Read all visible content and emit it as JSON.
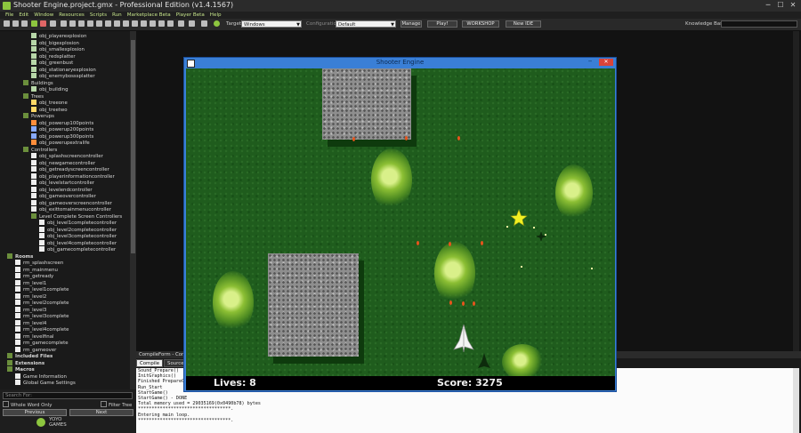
{
  "window": {
    "title": "Shooter Engine.project.gmx  -  Professional Edition (v1.4.1567)",
    "min": "─",
    "max": "☐",
    "close": "✕"
  },
  "menu": [
    "File",
    "Edit",
    "Window",
    "Resources",
    "Scripts",
    "Run",
    "Marketplace Beta",
    "Player Beta",
    "Help"
  ],
  "toolbar": {
    "target_label": "Target",
    "target_value": "Windows",
    "config_label": "Configuration",
    "config_value": "Default",
    "manage": "Manage",
    "play": "Play!",
    "workshop": "WORKSHOP",
    "new_ide": "New IDE",
    "kb_label": "Knowledge Base:"
  },
  "tree": [
    {
      "label": "obj_playerexplosion",
      "indent": 3,
      "icon": "obj"
    },
    {
      "label": "obj_bigexplosion",
      "indent": 3,
      "icon": "obj"
    },
    {
      "label": "obj_smallexplosion",
      "indent": 3,
      "icon": "obj"
    },
    {
      "label": "obj_redsplatter",
      "indent": 3,
      "icon": "obj"
    },
    {
      "label": "obj_greenbust",
      "indent": 3,
      "icon": "obj"
    },
    {
      "label": "obj_stationaryexplosion",
      "indent": 3,
      "icon": "obj"
    },
    {
      "label": "obj_enemybosssplatter",
      "indent": 3,
      "icon": "obj"
    },
    {
      "label": "Buildings",
      "indent": 2,
      "icon": "fld"
    },
    {
      "label": "obj_building",
      "indent": 3,
      "icon": "obj"
    },
    {
      "label": "Trees",
      "indent": 2,
      "icon": "fld"
    },
    {
      "label": "obj_treeone",
      "indent": 3,
      "icon": "tri"
    },
    {
      "label": "obj_treetwo",
      "indent": 3,
      "icon": "tri"
    },
    {
      "label": "Powerups",
      "indent": 2,
      "icon": "fld"
    },
    {
      "label": "obj_powerup100points",
      "indent": 3,
      "icon": "sel"
    },
    {
      "label": "obj_powerup200points",
      "indent": 3,
      "icon": "spr"
    },
    {
      "label": "obj_powerup300points",
      "indent": 3,
      "icon": "spr"
    },
    {
      "label": "obj_powerupextralife",
      "indent": 3,
      "icon": "sel"
    },
    {
      "label": "Controllers",
      "indent": 2,
      "icon": "fld"
    },
    {
      "label": "obj_splashscreencontroller",
      "indent": 3,
      "icon": "scr"
    },
    {
      "label": "obj_newgamecontroller",
      "indent": 3,
      "icon": "scr"
    },
    {
      "label": "obj_getreadyscreencontroller",
      "indent": 3,
      "icon": "scr"
    },
    {
      "label": "obj_playerinformationcontroller",
      "indent": 3,
      "icon": "scr"
    },
    {
      "label": "obj_levelstartcontroller",
      "indent": 3,
      "icon": "scr"
    },
    {
      "label": "obj_levelendcontroller",
      "indent": 3,
      "icon": "scr"
    },
    {
      "label": "obj_gameovercontroller",
      "indent": 3,
      "icon": "scr"
    },
    {
      "label": "obj_gameoverscreencontroller",
      "indent": 3,
      "icon": "scr"
    },
    {
      "label": "obj_exittomainmenucontroller",
      "indent": 3,
      "icon": "scr"
    },
    {
      "label": "Level Complete Screen Controllers",
      "indent": 3,
      "icon": "fld"
    },
    {
      "label": "obj_level1completecontroller",
      "indent": 4,
      "icon": "scr"
    },
    {
      "label": "obj_level2completecontroller",
      "indent": 4,
      "icon": "scr"
    },
    {
      "label": "obj_level3completecontroller",
      "indent": 4,
      "icon": "scr"
    },
    {
      "label": "obj_level4completecontroller",
      "indent": 4,
      "icon": "scr"
    },
    {
      "label": "obj_gamecompletecontroller",
      "indent": 4,
      "icon": "scr"
    },
    {
      "label": "Rooms",
      "indent": 0,
      "icon": "fld",
      "bold": true
    },
    {
      "label": "rm_splashscreen",
      "indent": 1,
      "icon": "scr"
    },
    {
      "label": "rm_mainmenu",
      "indent": 1,
      "icon": "scr"
    },
    {
      "label": "rm_getready",
      "indent": 1,
      "icon": "scr"
    },
    {
      "label": "rm_level1",
      "indent": 1,
      "icon": "scr"
    },
    {
      "label": "rm_level1complete",
      "indent": 1,
      "icon": "scr"
    },
    {
      "label": "rm_level2",
      "indent": 1,
      "icon": "scr"
    },
    {
      "label": "rm_level2complete",
      "indent": 1,
      "icon": "scr"
    },
    {
      "label": "rm_level3",
      "indent": 1,
      "icon": "scr"
    },
    {
      "label": "rm_level3complete",
      "indent": 1,
      "icon": "scr"
    },
    {
      "label": "rm_level4",
      "indent": 1,
      "icon": "scr"
    },
    {
      "label": "rm_level4complete",
      "indent": 1,
      "icon": "scr"
    },
    {
      "label": "rm_levelfinal",
      "indent": 1,
      "icon": "scr"
    },
    {
      "label": "rm_gamecomplete",
      "indent": 1,
      "icon": "scr"
    },
    {
      "label": "rm_gameover",
      "indent": 1,
      "icon": "scr"
    },
    {
      "label": "Included Files",
      "indent": 0,
      "icon": "fld",
      "bold": true
    },
    {
      "label": "Extensions",
      "indent": 0,
      "icon": "fld",
      "bold": true
    },
    {
      "label": "Macros",
      "indent": 0,
      "icon": "fld",
      "bold": true
    },
    {
      "label": "Game Information",
      "indent": 1,
      "icon": "scr"
    },
    {
      "label": "Global Game Settings",
      "indent": 1,
      "icon": "scr"
    }
  ],
  "left_panel": {
    "search_placeholder": "Search For:",
    "whole_word": "Whole Word Only",
    "filter_tree": "Filter Tree",
    "previous": "Previous",
    "next": "Next",
    "brand_line1": "YOYO",
    "brand_line2": "GAMES"
  },
  "compile": {
    "title": "CompileForm - Compile",
    "tabs": [
      "Compile",
      "Source Control"
    ],
    "log": [
      "Sound_Prepare()",
      "InitGraphics()",
      "Finished PrepareGame()",
      "Run_Start",
      "StartGame()",
      "StartGame() - DONE",
      "Total memory used = 29035169(0x0490b78) bytes",
      "**********************************.",
      "Entering main loop.",
      "**********************************."
    ]
  },
  "game": {
    "title": "Shooter Engine",
    "min": "─",
    "max": "☐",
    "close": "✕",
    "lives_label": "Lives: 8",
    "score_label": "Score: 3275"
  },
  "colors": {
    "accent_green": "#8dc63f",
    "menu_text": "#c6e48b",
    "game_titlebar": "#3a7fd6",
    "grass": "#1f5c1d"
  }
}
